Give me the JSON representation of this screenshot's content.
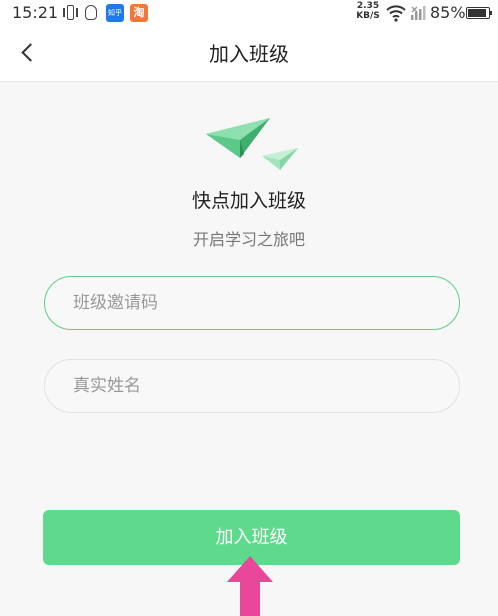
{
  "status_bar": {
    "time": "15:21",
    "zhihu_label": "知乎",
    "taobao_label": "淘",
    "net_speed_value": "2.35",
    "net_speed_unit": "KB/S",
    "battery": "85%"
  },
  "nav": {
    "title": "加入班级"
  },
  "hero": {
    "title": "快点加入班级",
    "subtitle": "开启学习之旅吧"
  },
  "form": {
    "invite_code_placeholder": "班级邀请码",
    "real_name_placeholder": "真实姓名",
    "submit_label": "加入班级"
  },
  "colors": {
    "accent": "#5fd98c",
    "focus_border": "#5dcf8a",
    "annotation_arrow": "#e8479a"
  }
}
